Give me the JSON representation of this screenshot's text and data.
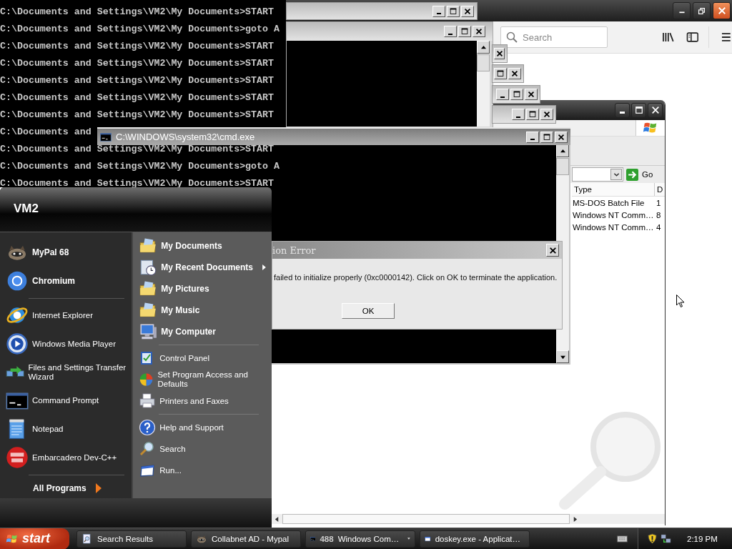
{
  "browser_window": {
    "search": {
      "placeholder": "Search"
    }
  },
  "search_results_window": {
    "go_button": "Go",
    "columns": [
      "Type",
      "D"
    ],
    "rows": [
      {
        "type": "MS-DOS Batch File",
        "column_2": "1"
      },
      {
        "type": "Windows NT Comm…",
        "column_2": "8"
      },
      {
        "type": "Windows NT Comm…",
        "column_2": "4"
      }
    ]
  },
  "cmd_window": {
    "title": "C:\\WINDOWS\\system32\\cmd.exe"
  },
  "console": {
    "lines": [
      "C:\\Documents and Settings\\VM2\\My Documents>START",
      "C:\\Documents and Settings\\VM2\\My Documents>goto A",
      "C:\\Documents and Settings\\VM2\\My Documents>START",
      "C:\\Documents and Settings\\VM2\\My Documents>START",
      "C:\\Documents and Settings\\VM2\\My Documents>START",
      "C:\\Documents and Settings\\VM2\\My Documents>START",
      "C:\\Documents and Settings\\VM2\\My Documents>START",
      "C:\\Documents and",
      "C:\\Documents and Settings\\VM2\\My Documents>START",
      "C:\\Documents and Settings\\VM2\\My Documents>goto A",
      "C:\\Documents and Settings\\VM2\\My Documents>START"
    ]
  },
  "error_dialog": {
    "title": "ion Error",
    "message": "failed to initialize properly (0xc0000142). Click on OK to terminate the application.",
    "button": "OK"
  },
  "start_menu": {
    "user": "VM2",
    "pinned": [
      {
        "label": "MyPal 68"
      },
      {
        "label": "Chromium"
      }
    ],
    "programs": [
      {
        "label": "Internet Explorer"
      },
      {
        "label": "Windows Media Player"
      },
      {
        "label": "Files and Settings Transfer Wizard"
      },
      {
        "label": "Command Prompt"
      },
      {
        "label": "Notepad"
      },
      {
        "label": "Embarcadero Dev-C++"
      }
    ],
    "all_programs": "All Programs",
    "place_groups": [
      {
        "emphasized": true,
        "items": [
          {
            "label": "My Documents",
            "submenu": false
          },
          {
            "label": "My Recent Documents",
            "submenu": true
          },
          {
            "label": "My Pictures",
            "submenu": false
          },
          {
            "label": "My Music",
            "submenu": false
          },
          {
            "label": "My Computer",
            "submenu": false
          }
        ]
      },
      {
        "emphasized": false,
        "items": [
          {
            "label": "Control Panel",
            "submenu": false
          },
          {
            "label": "Set Program Access and Defaults",
            "submenu": false
          },
          {
            "label": "Printers and Faxes",
            "submenu": false
          }
        ]
      },
      {
        "emphasized": false,
        "items": [
          {
            "label": "Help and Support",
            "submenu": false
          },
          {
            "label": "Search",
            "submenu": false
          },
          {
            "label": "Run...",
            "submenu": false
          }
        ]
      }
    ]
  },
  "taskbar": {
    "start": "start",
    "tasks": [
      {
        "label": "Search Results",
        "grouped": false
      },
      {
        "label": "Collabnet AD - Mypal",
        "grouped": false
      },
      {
        "count": "488",
        "label": "Windows Com…",
        "grouped": true
      },
      {
        "label": "doskey.exe - Applicat…",
        "grouped": false
      }
    ],
    "clock": "2:19 PM"
  }
}
